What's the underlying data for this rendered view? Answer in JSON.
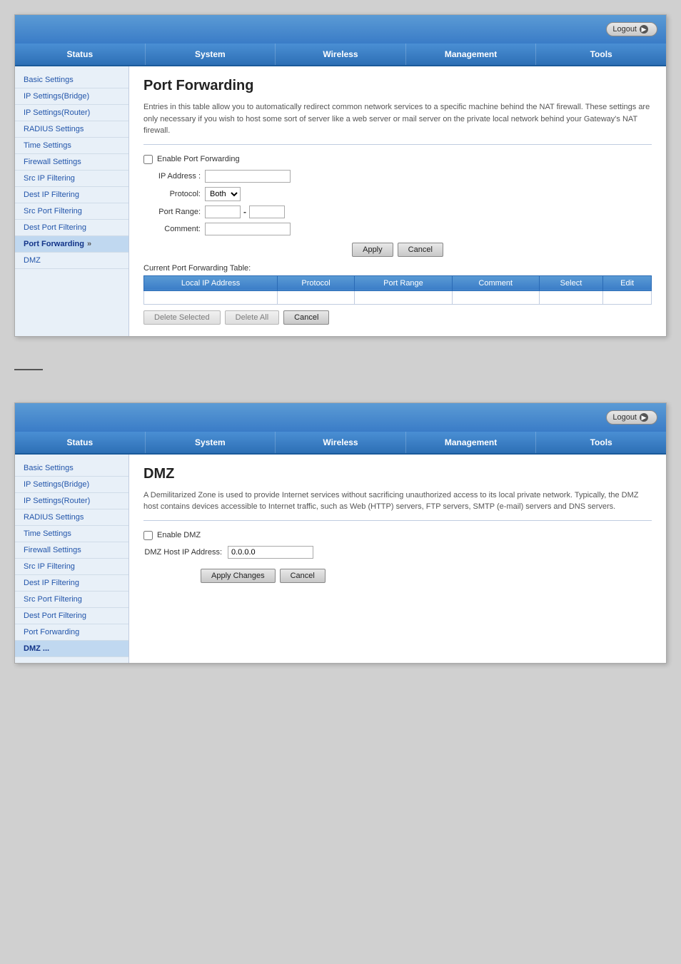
{
  "panels": [
    {
      "id": "port-forwarding-panel",
      "header": {
        "logout_label": "Logout"
      },
      "nav": {
        "items": [
          {
            "label": "Status",
            "active": false
          },
          {
            "label": "System",
            "active": false
          },
          {
            "label": "Wireless",
            "active": false
          },
          {
            "label": "Management",
            "active": false
          },
          {
            "label": "Tools",
            "active": false
          }
        ]
      },
      "sidebar": {
        "items": [
          {
            "label": "Basic Settings",
            "active": false
          },
          {
            "label": "IP Settings(Bridge)",
            "active": false
          },
          {
            "label": "IP Settings(Router)",
            "active": false
          },
          {
            "label": "RADIUS Settings",
            "active": false
          },
          {
            "label": "Time Settings",
            "active": false
          },
          {
            "label": "Firewall Settings",
            "active": false
          },
          {
            "label": "Src IP Filtering",
            "active": false
          },
          {
            "label": "Dest IP Filtering",
            "active": false
          },
          {
            "label": "Src Port Filtering",
            "active": false
          },
          {
            "label": "Dest Port Filtering",
            "active": false
          },
          {
            "label": "Port Forwarding",
            "active": true
          },
          {
            "label": "DMZ",
            "active": false
          }
        ]
      },
      "content": {
        "title": "Port Forwarding",
        "description": "Entries in this table allow you to automatically redirect common network services to a specific machine behind the NAT firewall. These settings are only necessary if you wish to host some sort of server like a web server or mail server on the private local network behind your Gateway's NAT firewall.",
        "enable_label": "Enable Port Forwarding",
        "ip_address_label": "IP Address :",
        "protocol_label": "Protocol:",
        "protocol_default": "Both",
        "port_range_label": "Port Range:",
        "comment_label": "Comment:",
        "apply_btn": "Apply",
        "cancel_btn": "Cancel",
        "table_title": "Current Port Forwarding Table:",
        "table_headers": [
          "Local IP Address",
          "Protocol",
          "Port Range",
          "Comment",
          "Select",
          "Edit"
        ],
        "delete_selected_btn": "Delete Selected",
        "delete_all_btn": "Delete All",
        "cancel_table_btn": "Cancel"
      }
    },
    {
      "id": "dmz-panel",
      "header": {
        "logout_label": "Logout"
      },
      "nav": {
        "items": [
          {
            "label": "Status",
            "active": false
          },
          {
            "label": "System",
            "active": false
          },
          {
            "label": "Wireless",
            "active": false
          },
          {
            "label": "Management",
            "active": false
          },
          {
            "label": "Tools",
            "active": false
          }
        ]
      },
      "sidebar": {
        "items": [
          {
            "label": "Basic Settings",
            "active": false
          },
          {
            "label": "IP Settings(Bridge)",
            "active": false
          },
          {
            "label": "IP Settings(Router)",
            "active": false
          },
          {
            "label": "RADIUS Settings",
            "active": false
          },
          {
            "label": "Time Settings",
            "active": false
          },
          {
            "label": "Firewall Settings",
            "active": false
          },
          {
            "label": "Src IP Filtering",
            "active": false
          },
          {
            "label": "Dest IP Filtering",
            "active": false
          },
          {
            "label": "Src Port Filtering",
            "active": false
          },
          {
            "label": "Dest Port Filtering",
            "active": false
          },
          {
            "label": "Port Forwarding",
            "active": false
          },
          {
            "label": "DMZ ...",
            "active": true
          }
        ]
      },
      "content": {
        "title": "DMZ",
        "description": "A Demilitarized Zone is used to provide Internet services without sacrificing unauthorized access to its local private network. Typically, the DMZ host contains devices accessible to Internet traffic, such as Web (HTTP) servers, FTP servers, SMTP (e-mail) servers and DNS servers.",
        "enable_label": "Enable DMZ",
        "dmz_host_label": "DMZ Host IP Address:",
        "dmz_host_value": "0.0.0.0",
        "apply_btn": "Apply Changes",
        "cancel_btn": "Cancel"
      }
    }
  ]
}
